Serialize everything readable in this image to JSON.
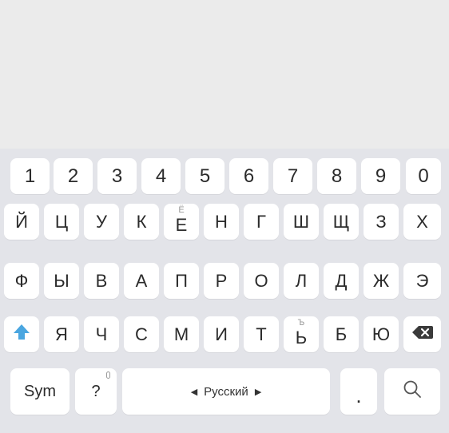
{
  "keyboard": {
    "rows": [
      [
        "1",
        "2",
        "3",
        "4",
        "5",
        "6",
        "7",
        "8",
        "9",
        "0"
      ],
      [
        "Й",
        "Ц",
        "У",
        "К",
        "Е",
        "Н",
        "Г",
        "Ш",
        "Щ",
        "З",
        "Х"
      ],
      [
        "Ф",
        "Ы",
        "В",
        "А",
        "П",
        "Р",
        "О",
        "Л",
        "Д",
        "Ж",
        "Э"
      ],
      [
        "Я",
        "Ч",
        "С",
        "М",
        "И",
        "Т",
        "Ь",
        "Б",
        "Ю"
      ]
    ],
    "hints": {
      "e_alt": "Ё",
      "soft_alt": "Ъ"
    },
    "bottom": {
      "sym": "Sym",
      "question": "?",
      "space_label": "Русский",
      "period": "."
    },
    "accent_color": "#4aa6e0",
    "icons": {
      "shift": "shift-icon",
      "backspace": "backspace-icon",
      "search": "search-icon",
      "left_arrow": "left-arrow-icon",
      "right_arrow": "right-arrow-icon",
      "mic": "mic-icon"
    }
  }
}
